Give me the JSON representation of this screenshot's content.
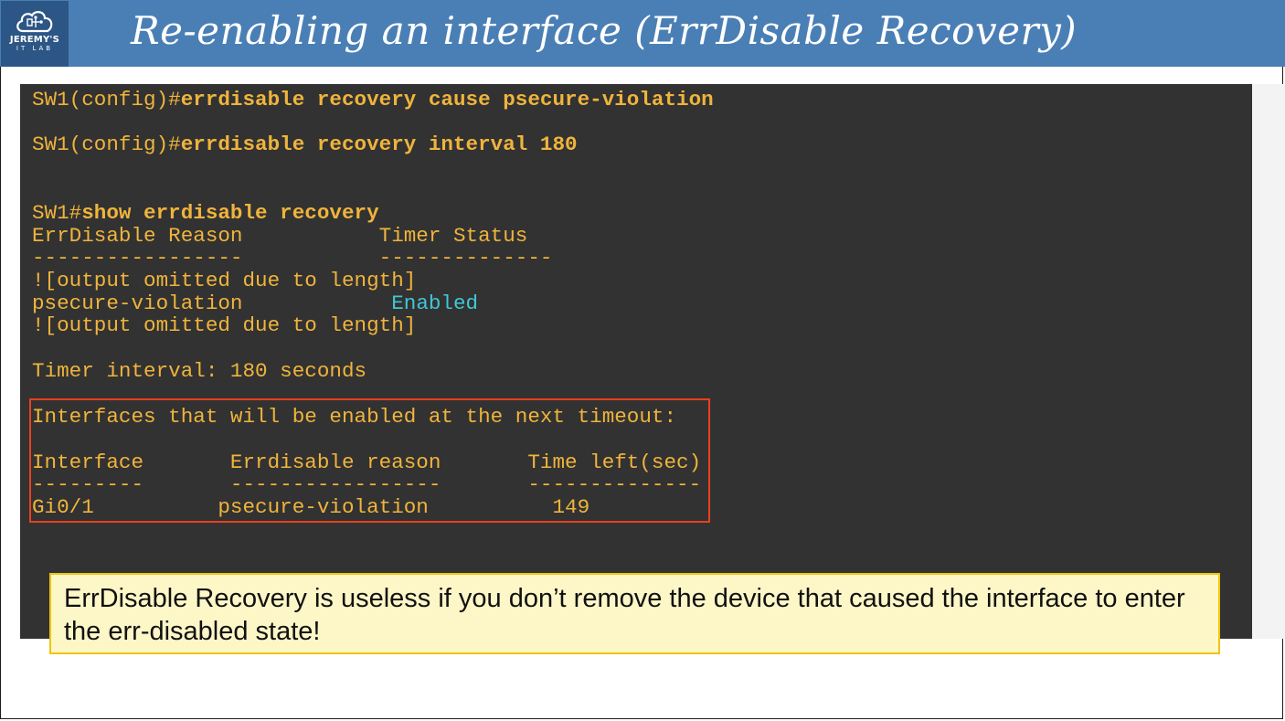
{
  "header": {
    "title": "Re-enabling an interface (ErrDisable Recovery)",
    "logo": {
      "icon": "cloud-chip-icon",
      "line1": "JEREMY'S",
      "line2": "IT LAB"
    }
  },
  "terminal": {
    "cmd1": {
      "prompt": "SW1(config)#",
      "command": "errdisable recovery cause psecure-violation"
    },
    "cmd2": {
      "prompt": "SW1(config)#",
      "command": "errdisable recovery interval 180"
    },
    "cmd3": {
      "prompt": "SW1#",
      "command": "show errdisable recovery"
    },
    "table_header": "ErrDisable Reason           Timer Status",
    "table_divider": "-----------------           --------------",
    "omitted1": "![output omitted due to length]",
    "reason": "psecure-violation",
    "reason_status": "Enabled",
    "omitted2": "![output omitted due to length]",
    "timer_interval": "Timer interval: 180 seconds",
    "next_timeout_title": "Interfaces that will be enabled at the next timeout:",
    "iface_header": "Interface       Errdisable reason       Time left(sec)",
    "iface_divider": "---------       -----------------       --------------",
    "iface_row": "Gi0/1          psecure-violation          149"
  },
  "callout": {
    "text": "ErrDisable Recovery is useless if you don’t remove the device that caused the interface to enter the err-disabled state!"
  },
  "colors": {
    "header_bg": "#4a7fb5",
    "logo_bg": "#2c5685",
    "terminal_bg": "#323232",
    "terminal_text": "#f0b43c",
    "enabled_text": "#3fc7d6",
    "highlight_border": "#e8401c",
    "callout_bg": "#fdf6c7",
    "callout_border": "#f1c40f"
  }
}
